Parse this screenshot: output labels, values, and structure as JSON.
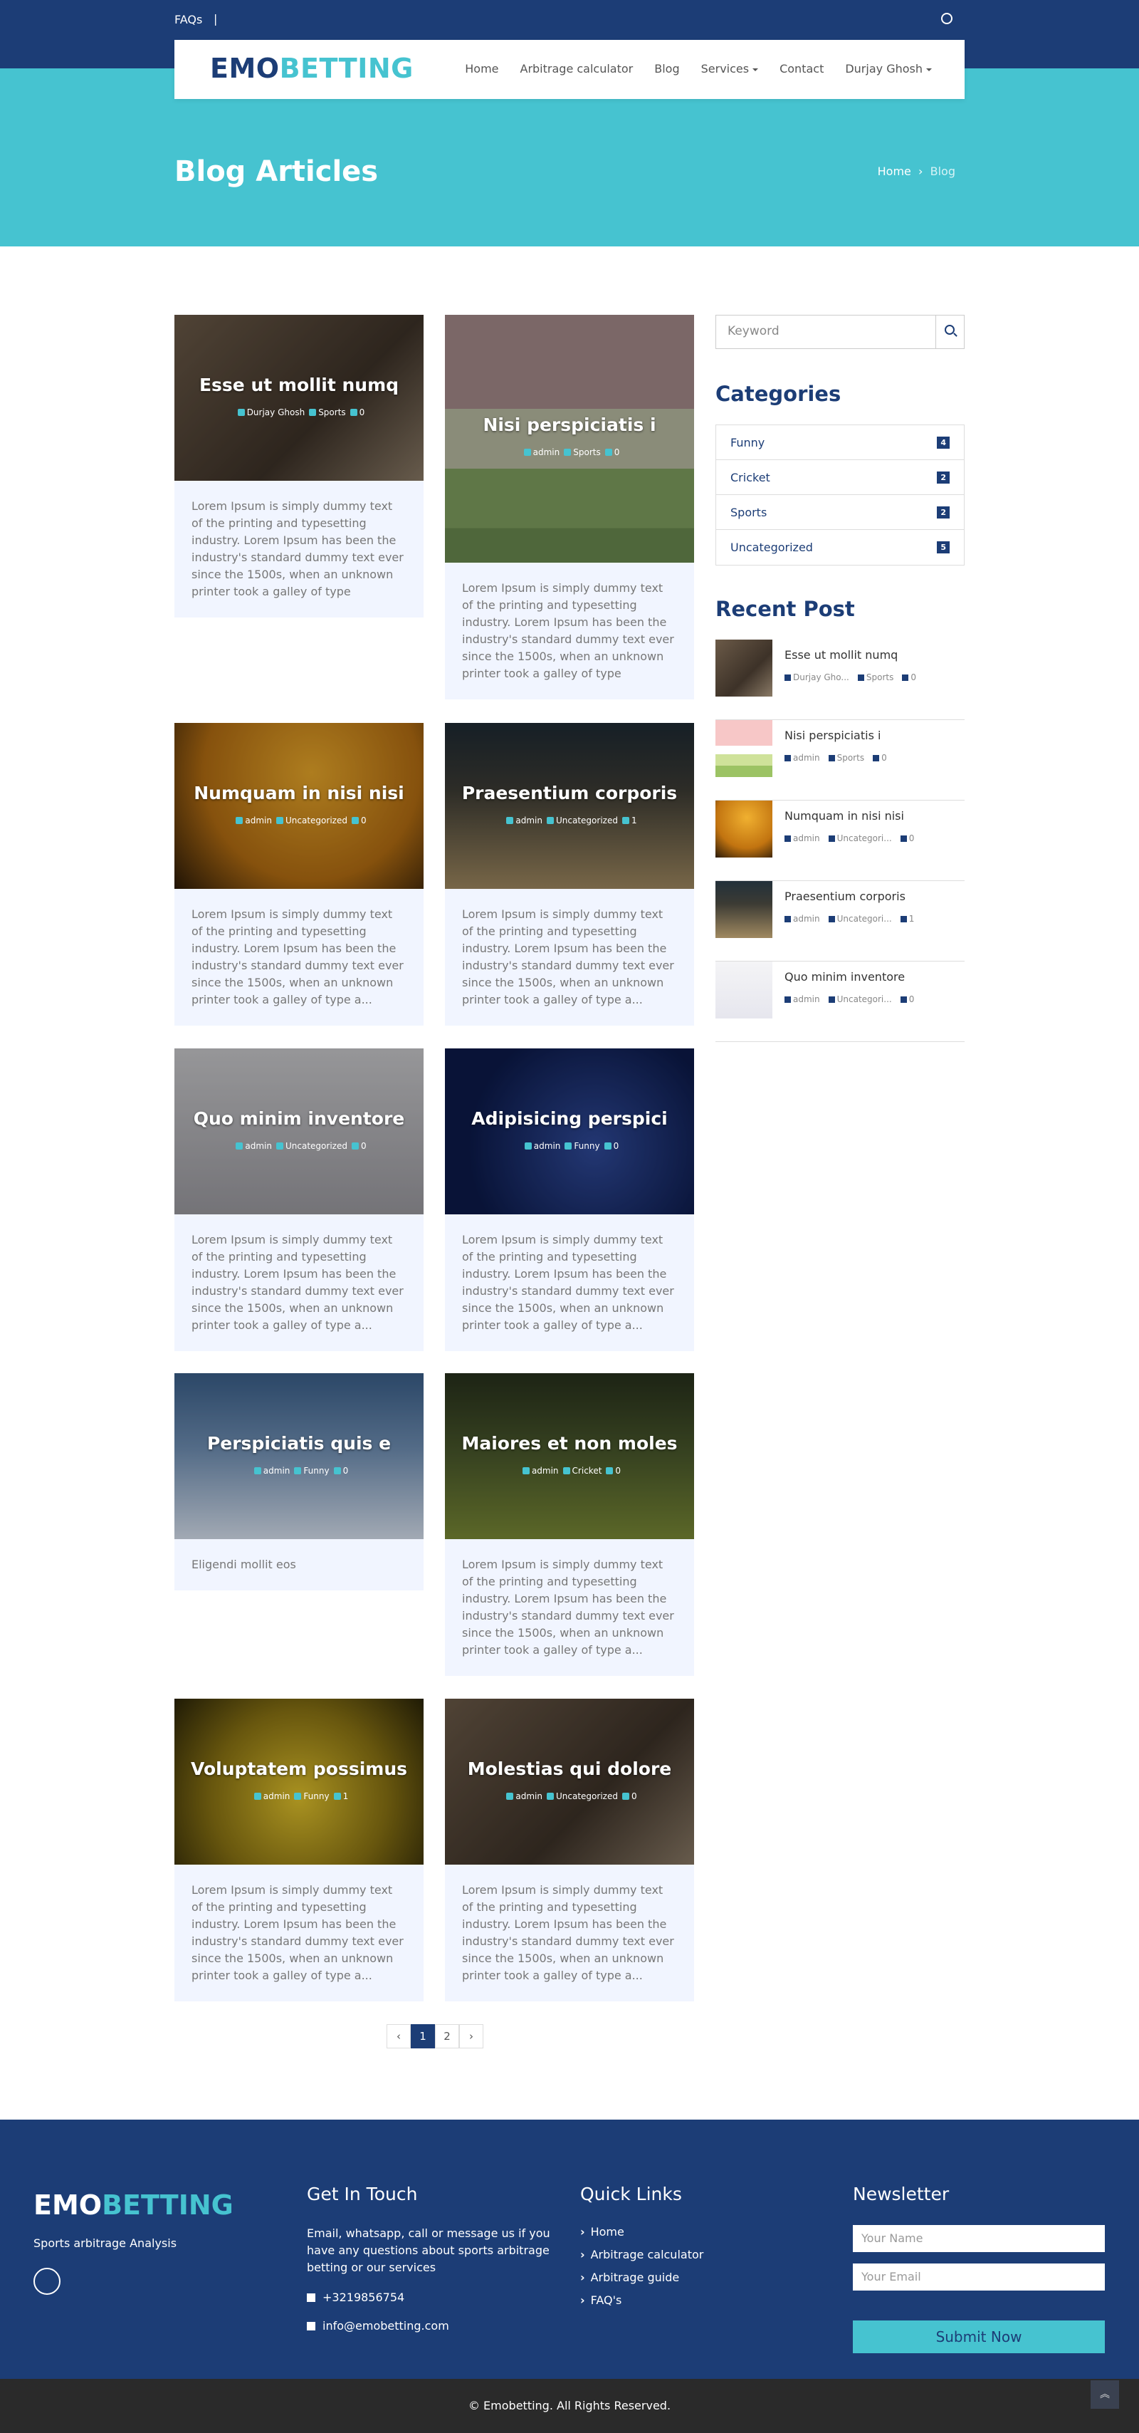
{
  "top": {
    "faq": "FAQs",
    "sep": "|"
  },
  "brand": {
    "a": "EMO",
    "b": "BETTING"
  },
  "nav": [
    "Home",
    "Arbitrage calculator",
    "Blog",
    "Services",
    "Contact",
    "Durjay Ghosh"
  ],
  "hero": {
    "title": "Blog Articles",
    "crumb_home": "Home",
    "crumb_cur": "Blog"
  },
  "posts": [
    {
      "title": "Esse ut mollit numq",
      "author": "Durjay Ghosh",
      "cat": "Sports",
      "cmt": "0",
      "text": "Lorem Ipsum is simply dummy text of the printing and typesetting industry. Lorem Ipsum has been the industry's standard dummy text ever since the 1500s, when an unknown printer took a galley of type"
    },
    {
      "title": "Nisi perspiciatis i",
      "author": "admin",
      "cat": "Sports",
      "cmt": "0",
      "text": "Lorem Ipsum is simply dummy text of the printing and typesetting industry. Lorem Ipsum has been the industry's standard dummy text ever since the 1500s, when an unknown printer took a galley of type"
    },
    {
      "title": "Numquam in nisi nisi",
      "author": "admin",
      "cat": "Uncategorized",
      "cmt": "0",
      "text": "Lorem Ipsum is simply dummy text of the printing and typesetting industry. Lorem Ipsum has been the industry's standard dummy text ever since the 1500s, when an unknown printer took a galley of type a..."
    },
    {
      "title": "Praesentium corporis",
      "author": "admin",
      "cat": "Uncategorized",
      "cmt": "1",
      "text": "Lorem Ipsum is simply dummy text of the printing and typesetting industry. Lorem Ipsum has been the industry's standard dummy text ever since the 1500s, when an unknown printer took a galley of type a..."
    },
    {
      "title": "Quo minim inventore",
      "author": "admin",
      "cat": "Uncategorized",
      "cmt": "0",
      "text": "Lorem Ipsum is simply dummy text of the printing and typesetting industry. Lorem Ipsum has been the industry's standard dummy text ever since the 1500s, when an unknown printer took a galley of type a..."
    },
    {
      "title": "Adipisicing perspici",
      "author": "admin",
      "cat": "Funny",
      "cmt": "0",
      "text": "Lorem Ipsum is simply dummy text of the printing and typesetting industry. Lorem Ipsum has been the industry's standard dummy text ever since the 1500s, when an unknown printer took a galley of type a..."
    },
    {
      "title": "Perspiciatis quis e",
      "author": "admin",
      "cat": "Funny",
      "cmt": "0",
      "text": "Eligendi mollit eos"
    },
    {
      "title": "Maiores et non moles",
      "author": "admin",
      "cat": "Cricket",
      "cmt": "0",
      "text": "Lorem Ipsum is simply dummy text of the printing and typesetting industry. Lorem Ipsum has been the industry's standard dummy text ever since the 1500s, when an unknown printer took a galley of type a..."
    },
    {
      "title": "Voluptatem possimus",
      "author": "admin",
      "cat": "Funny",
      "cmt": "1",
      "text": "Lorem Ipsum is simply dummy text of the printing and typesetting industry. Lorem Ipsum has been the industry's standard dummy text ever since the 1500s, when an unknown printer took a galley of type a..."
    },
    {
      "title": "Molestias qui dolore",
      "author": "admin",
      "cat": "Uncategorized",
      "cmt": "0",
      "text": "Lorem Ipsum is simply dummy text of the printing and typesetting industry. Lorem Ipsum has been the industry's standard dummy text ever since the 1500s, when an unknown printer took a galley of type a..."
    }
  ],
  "sidebar": {
    "search_placeholder": "Keyword",
    "cat_title": "Categories",
    "categories": [
      {
        "name": "Funny",
        "count": "4"
      },
      {
        "name": "Cricket",
        "count": "2"
      },
      {
        "name": "Sports",
        "count": "2"
      },
      {
        "name": "Uncategorized",
        "count": "5"
      }
    ],
    "recent_title": "Recent Post",
    "recent": [
      {
        "title": "Esse ut mollit numq",
        "author": "Durjay Gho...",
        "cat": "Sports",
        "cmt": "0"
      },
      {
        "title": "Nisi perspiciatis i",
        "author": "admin",
        "cat": "Sports",
        "cmt": "0"
      },
      {
        "title": "Numquam in nisi nisi",
        "author": "admin",
        "cat": "Uncategori...",
        "cmt": "0"
      },
      {
        "title": "Praesentium corporis",
        "author": "admin",
        "cat": "Uncategori...",
        "cmt": "1"
      },
      {
        "title": "Quo minim inventore",
        "author": "admin",
        "cat": "Uncategori...",
        "cmt": "0"
      }
    ]
  },
  "pager": [
    "‹",
    "1",
    "2",
    "›"
  ],
  "footer": {
    "tagline": "Sports arbitrage Analysis",
    "touch_title": "Get In Touch",
    "touch_text": "Email, whatsapp, call or message us if you have any questions about sports arbitrage betting or our services",
    "phone": "+3219856754",
    "email": "info@emobetting.com",
    "links_title": "Quick Links",
    "links": [
      "Home",
      "Arbitrage calculator",
      "Arbitrage guide",
      "FAQ's"
    ],
    "news_title": "Newsletter",
    "name_ph": "Your Name",
    "email_ph": "Your Email",
    "submit": "Submit Now",
    "copyright": "© Emobetting. All Rights Reserved."
  }
}
